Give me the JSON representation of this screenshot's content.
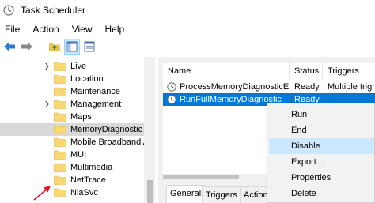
{
  "window": {
    "title": "Task Scheduler"
  },
  "menubar": [
    "File",
    "Action",
    "View",
    "Help"
  ],
  "toolbar": {
    "buttons": [
      "back-arrow-icon",
      "forward-arrow-icon",
      "folder-up-icon",
      "show-hide-console-tree-icon",
      "help-icon"
    ]
  },
  "tree": {
    "items": [
      {
        "label": "Live",
        "selected": false
      },
      {
        "label": "Location",
        "selected": false
      },
      {
        "label": "Maintenance",
        "selected": false
      },
      {
        "label": "Management",
        "selected": false
      },
      {
        "label": "Maps",
        "selected": false
      },
      {
        "label": "MemoryDiagnostic",
        "selected": true
      },
      {
        "label": "Mobile Broadband A",
        "selected": false
      },
      {
        "label": "MUI",
        "selected": false
      },
      {
        "label": "Multimedia",
        "selected": false
      },
      {
        "label": "NetTrace",
        "selected": false
      },
      {
        "label": "NlaSvc",
        "selected": false
      }
    ]
  },
  "task_list": {
    "columns": [
      "Name",
      "Status",
      "Triggers"
    ],
    "rows": [
      {
        "name": "ProcessMemoryDiagnosticE...",
        "status": "Ready",
        "triggers": "Multiple trig",
        "selected": false
      },
      {
        "name": "RunFullMemoryDiagnostic",
        "status": "Ready",
        "triggers": "",
        "selected": true
      }
    ]
  },
  "detail_tabs": [
    "General",
    "Triggers",
    "Action"
  ],
  "context_menu": {
    "items": [
      {
        "label": "Run",
        "highlighted": false
      },
      {
        "label": "End",
        "highlighted": false
      },
      {
        "label": "Disable",
        "highlighted": true
      },
      {
        "label": "Export...",
        "highlighted": false
      },
      {
        "label": "Properties",
        "highlighted": false
      },
      {
        "label": "Delete",
        "highlighted": false
      }
    ]
  },
  "colors": {
    "selection_blue": "#0078d7",
    "menu_highlight": "#cce8ff",
    "folder_yellow": "#f8d775",
    "annotation_red": "#e81123"
  }
}
